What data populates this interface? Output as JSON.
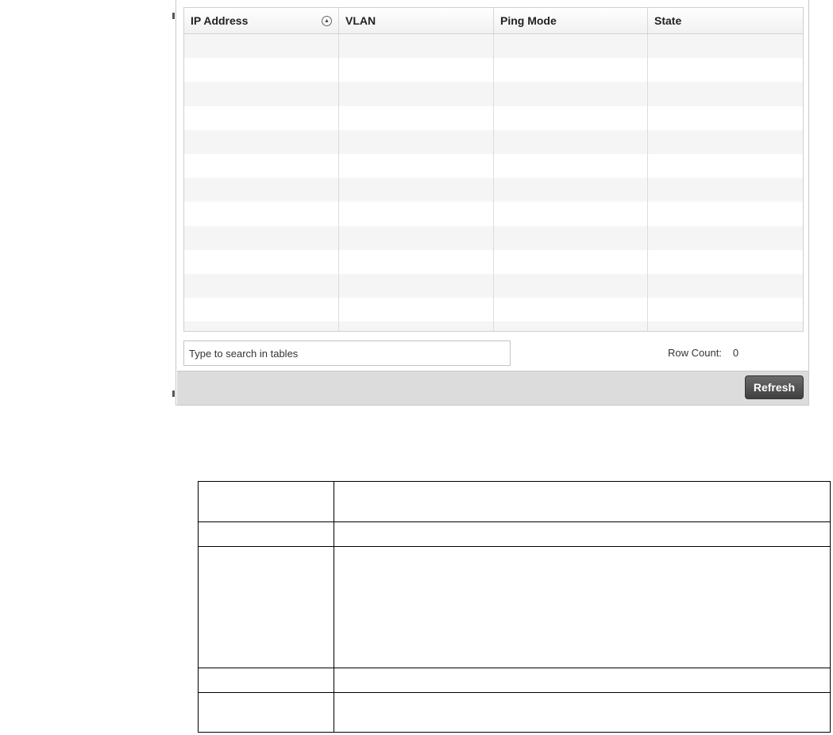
{
  "table": {
    "columns": [
      "IP Address",
      "VLAN",
      "Ping Mode",
      "State"
    ],
    "sort_icon": "sort-ascending-icon",
    "rows": []
  },
  "search": {
    "placeholder": "Type to search in tables"
  },
  "row_count": {
    "label": "Row Count:",
    "value": "0"
  },
  "footer": {
    "refresh_label": "Refresh"
  },
  "colors": {
    "refresh_bg": "#4a4a4a",
    "footer_bg": "#dcdcdc",
    "stripe": "#f5f5f5"
  }
}
